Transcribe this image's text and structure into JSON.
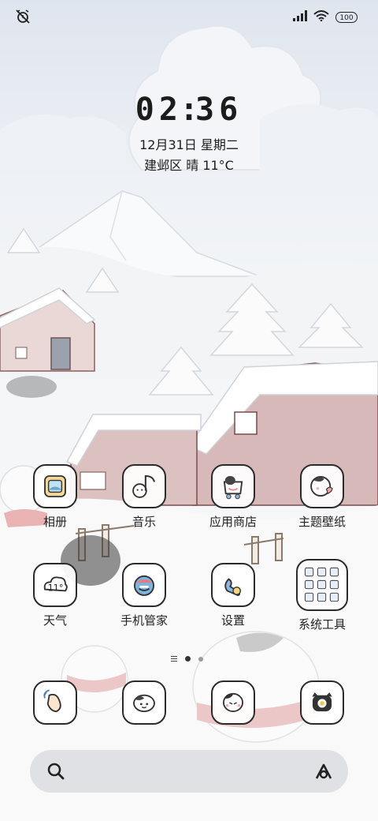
{
  "status_bar": {
    "battery": "100"
  },
  "lockscreen": {
    "clock_digits": [
      "0",
      "2",
      ":",
      "3",
      "6"
    ],
    "date": "12月31日 星期二",
    "weather": "建邺区 晴 11°C"
  },
  "apps": [
    {
      "label": "相册",
      "icon": "album-icon"
    },
    {
      "label": "音乐",
      "icon": "music-icon"
    },
    {
      "label": "应用商店",
      "icon": "app-store-icon"
    },
    {
      "label": "主题壁纸",
      "icon": "theme-icon"
    },
    {
      "label": "天气",
      "icon": "weather-icon",
      "icon_text": "11°"
    },
    {
      "label": "手机管家",
      "icon": "security-icon"
    },
    {
      "label": "设置",
      "icon": "settings-icon"
    },
    {
      "label": "系统工具",
      "icon": "folder-icon"
    }
  ],
  "dock": [
    {
      "icon": "phone-icon"
    },
    {
      "icon": "messages-icon"
    },
    {
      "icon": "browser-icon"
    },
    {
      "icon": "camera-icon"
    }
  ],
  "page_indicator": {
    "pages": 2,
    "active": 1
  },
  "search_bar": {
    "left_icon": "search-icon",
    "right_icon": "assistant-icon"
  }
}
